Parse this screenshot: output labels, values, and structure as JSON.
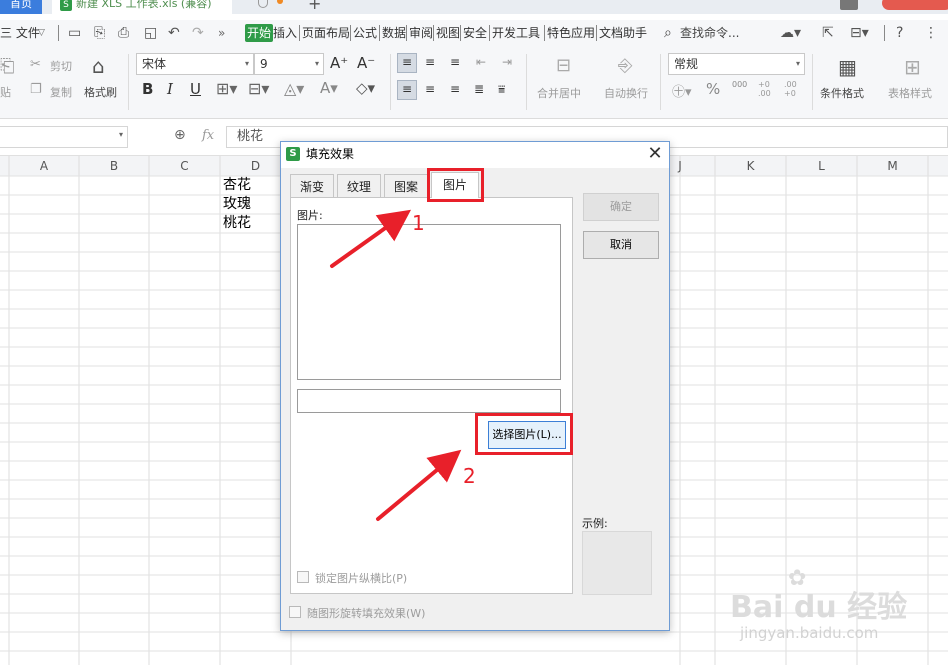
{
  "titlebar": {
    "home_tab": "首页",
    "doc_tab": "新建 XLS 工作表.xls (兼容)",
    "new_tab": "+"
  },
  "menubar": {
    "file": "三 文件",
    "items": [
      "开始",
      "插入",
      "页面布局",
      "公式",
      "数据",
      "审阅",
      "视图",
      "安全",
      "开发工具",
      "特色应用",
      "文档助手"
    ],
    "search": "查找命令..."
  },
  "ribbon": {
    "paste": "贴",
    "cut": "剪切",
    "copy": "复制",
    "format_painter": "格式刷",
    "font_name": "宋体",
    "font_size": "9",
    "merge_center": "合并居中",
    "auto_wrap": "自动换行",
    "number_format": "常规",
    "conditional_format": "条件格式",
    "table_style": "表格样式",
    "percent": "%",
    "thousands": "000",
    "dec_inc": "+0 .00",
    "dec_dec": ".00 +0"
  },
  "formula_bar": {
    "fx": "fx",
    "value": "桃花"
  },
  "sheet": {
    "columns": [
      "A",
      "B",
      "C",
      "D",
      "J",
      "K",
      "L",
      "M"
    ],
    "cells": [
      "杏花",
      "玫瑰",
      "桃花"
    ]
  },
  "dialog": {
    "title": "填充效果",
    "close": "✕",
    "tabs": [
      "渐变",
      "纹理",
      "图案",
      "图片"
    ],
    "active_tab": "图片",
    "picture_label": "图片:",
    "select_button": "选择图片(L)...",
    "ok_button": "确定",
    "cancel_button": "取消",
    "lock_aspect": "锁定图片纵横比(P)",
    "rotate_with_shape": "随图形旋转填充效果(W)",
    "sample_label": "示例:"
  },
  "annotations": {
    "step1": "1",
    "step2": "2",
    "color": "#e8202a"
  },
  "watermark": {
    "brand": "Bai du 经验",
    "url": "jingyan.baidu.com"
  }
}
